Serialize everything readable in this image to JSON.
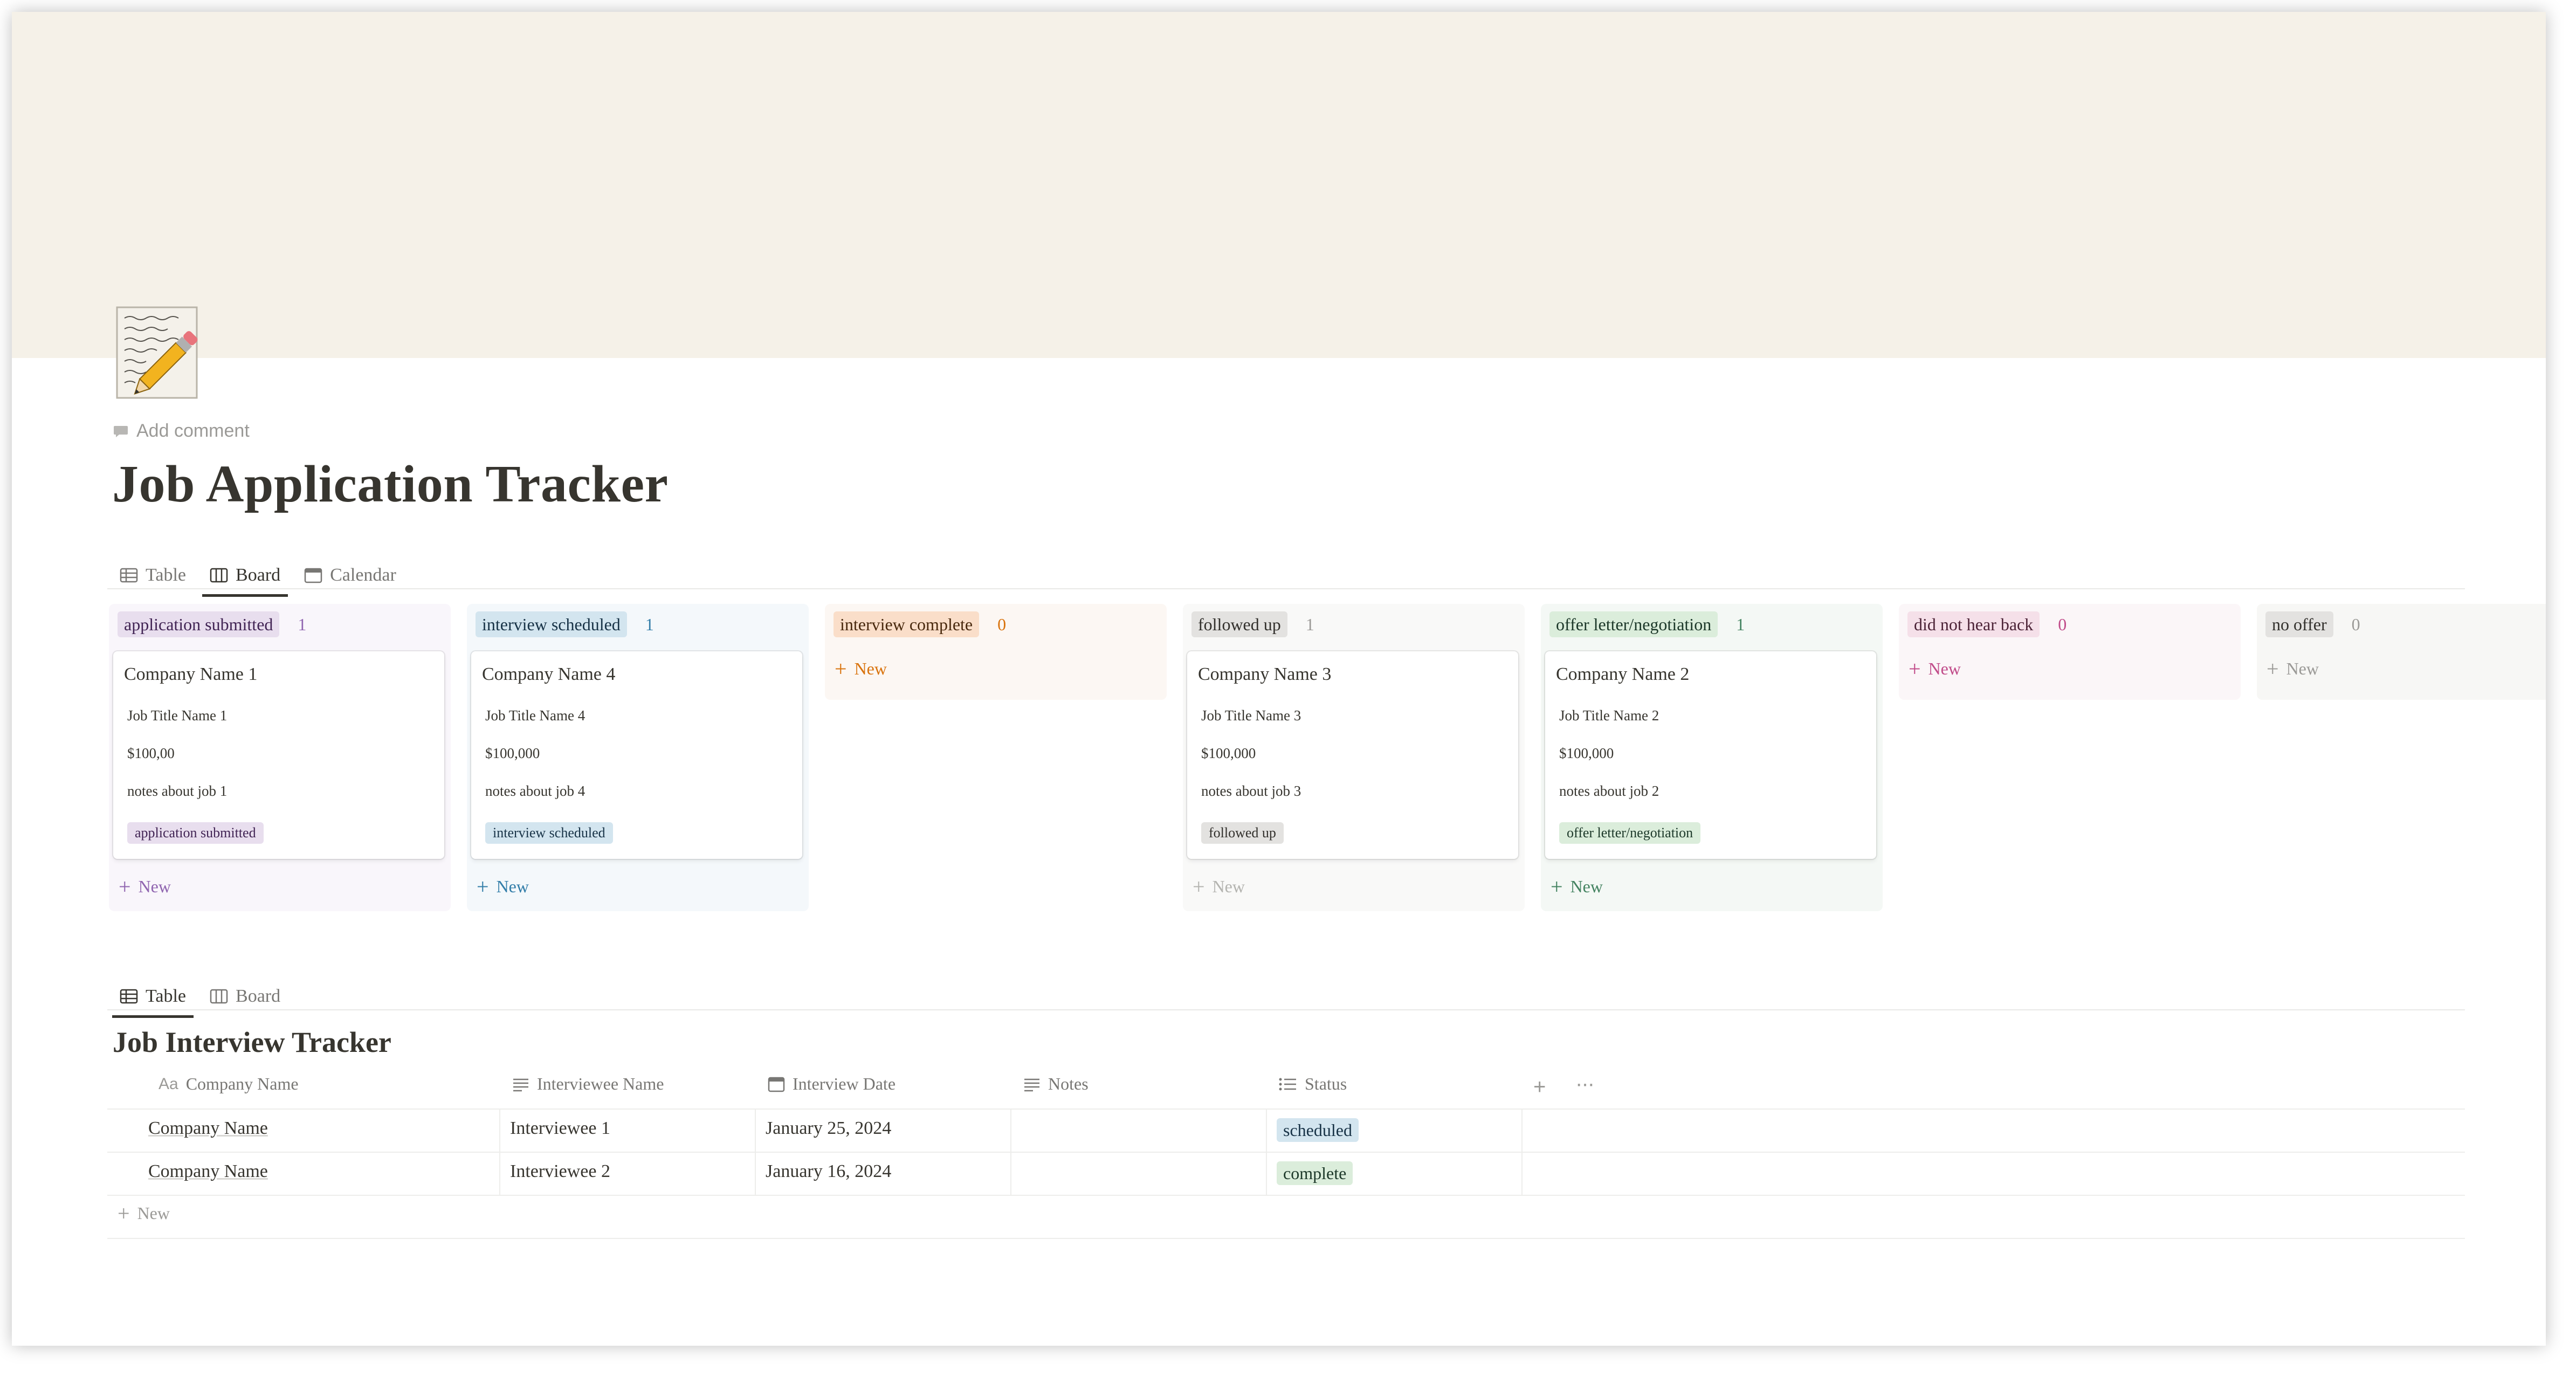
{
  "page": {
    "title": "Job Application Tracker",
    "add_comment": "Add comment",
    "icon": "memo-pencil-icon"
  },
  "top_views": {
    "tabs": [
      {
        "label": "Table",
        "icon": "table-icon",
        "active": false
      },
      {
        "label": "Board",
        "icon": "board-icon",
        "active": true
      },
      {
        "label": "Calendar",
        "icon": "calendar-icon",
        "active": false
      }
    ]
  },
  "board": {
    "new_label": "New",
    "columns": [
      {
        "name": "application submitted",
        "count": "1",
        "bg": "#f9f6fb",
        "pill_bg": "#e8deee",
        "pill_fg": "#412454",
        "count_fg": "#9065b0",
        "new_fg": "#9065b0",
        "card": {
          "title": "Company Name 1",
          "job": "Job Title Name 1",
          "salary": "$100,00",
          "notes": "notes about job 1",
          "badge": "application submitted"
        }
      },
      {
        "name": "interview scheduled",
        "count": "1",
        "bg": "#f4f8fb",
        "pill_bg": "#d3e5ef",
        "pill_fg": "#183347",
        "count_fg": "#337ea9",
        "new_fg": "#337ea9",
        "card": {
          "title": "Company Name 4",
          "job": "Job Title Name 4",
          "salary": "$100,000",
          "notes": "notes about job 4",
          "badge": "interview scheduled"
        }
      },
      {
        "name": "interview complete",
        "count": "0",
        "bg": "#fcf7f3",
        "pill_bg": "#fadec9",
        "pill_fg": "#49290e",
        "count_fg": "#d9730d",
        "new_fg": "#d9730d",
        "card": null
      },
      {
        "name": "followed up",
        "count": "1",
        "bg": "#f9f9f8",
        "pill_bg": "#e3e2e0",
        "pill_fg": "#32302c",
        "count_fg": "#9b9a97",
        "new_fg": "#b4b4b0",
        "card": {
          "title": "Company Name 3",
          "job": "Job Title Name 3",
          "salary": "$100,000",
          "notes": "notes about job 3",
          "badge": "followed up"
        }
      },
      {
        "name": "offer letter/negotiation",
        "count": "1",
        "bg": "#f4f8f5",
        "pill_bg": "#dbeddb",
        "pill_fg": "#1c3829",
        "count_fg": "#448361",
        "new_fg": "#448361",
        "card": {
          "title": "Company Name 2",
          "job": "Job Title Name 2",
          "salary": "$100,000",
          "notes": "notes about job 2",
          "badge": "offer letter/negotiation"
        }
      },
      {
        "name": "did not hear back",
        "count": "0",
        "bg": "#fbf6f8",
        "pill_bg": "#f5e0e9",
        "pill_fg": "#4c2337",
        "count_fg": "#c14c8a",
        "new_fg": "#c14c8a",
        "card": null
      },
      {
        "name": "no offer",
        "count": "0",
        "bg": "#f7f7f5",
        "pill_bg": "#e3e2e0",
        "pill_fg": "#32302c",
        "count_fg": "#9b9a97",
        "new_fg": "#9b9a97",
        "card": null
      }
    ]
  },
  "bottom_views": {
    "tabs": [
      {
        "label": "Table",
        "icon": "table-icon",
        "active": true
      },
      {
        "label": "Board",
        "icon": "board-icon",
        "active": false
      }
    ]
  },
  "interview_table": {
    "title": "Job Interview Tracker",
    "columns": [
      {
        "label": "Company Name",
        "icon": "title-property-icon"
      },
      {
        "label": "Interviewee Name",
        "icon": "text-property-icon"
      },
      {
        "label": "Interview Date",
        "icon": "date-property-icon"
      },
      {
        "label": "Notes",
        "icon": "text-property-icon"
      },
      {
        "label": "Status",
        "icon": "status-property-icon"
      }
    ],
    "rows": [
      {
        "company": "Company Name",
        "interviewee": "Interviewee 1",
        "date": "January 25, 2024",
        "notes": "",
        "status": "scheduled",
        "status_bg": "#d3e5ef",
        "status_fg": "#183347"
      },
      {
        "company": "Company Name",
        "interviewee": "Interviewee 2",
        "date": "January 16, 2024",
        "notes": "",
        "status": "complete",
        "status_bg": "#dbeddb",
        "status_fg": "#1c3829"
      }
    ],
    "new_label": "New"
  }
}
